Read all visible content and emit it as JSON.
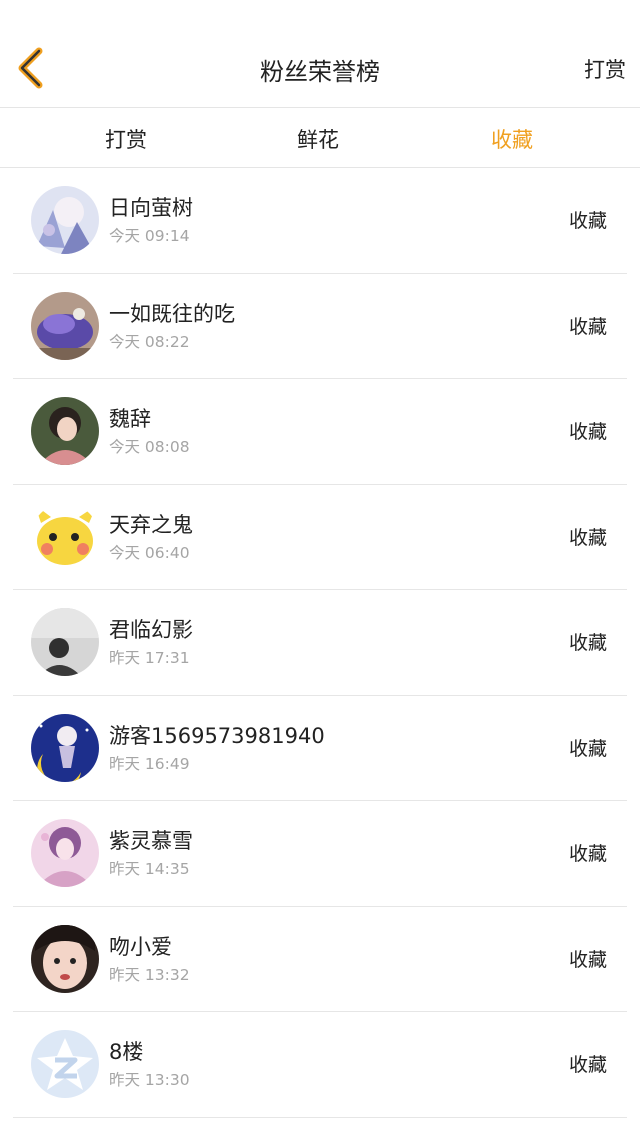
{
  "header": {
    "title": "粉丝荣誉榜",
    "action_label": "打赏",
    "back_icon": "chevron-left-icon",
    "accent_color": "#f0a020"
  },
  "tabs": [
    {
      "label": "打赏",
      "active": false
    },
    {
      "label": "鲜花",
      "active": false
    },
    {
      "label": "收藏",
      "active": true
    }
  ],
  "list": [
    {
      "name": "日向萤树",
      "time": "今天 09:14",
      "action": "收藏"
    },
    {
      "name": "一如既往的吃",
      "time": "今天 08:22",
      "action": "收藏"
    },
    {
      "name": "魏辞",
      "time": "今天 08:08",
      "action": "收藏"
    },
    {
      "name": "天弃之鬼",
      "time": "今天 06:40",
      "action": "收藏"
    },
    {
      "name": "君临幻影",
      "time": "昨天 17:31",
      "action": "收藏"
    },
    {
      "name": "游客1569573981940",
      "time": "昨天 16:49",
      "action": "收藏"
    },
    {
      "name": "紫灵慕雪",
      "time": "昨天 14:35",
      "action": "收藏"
    },
    {
      "name": "吻小爱",
      "time": "昨天 13:32",
      "action": "收藏"
    },
    {
      "name": "8楼",
      "time": "昨天 13:30",
      "action": "收藏"
    }
  ]
}
